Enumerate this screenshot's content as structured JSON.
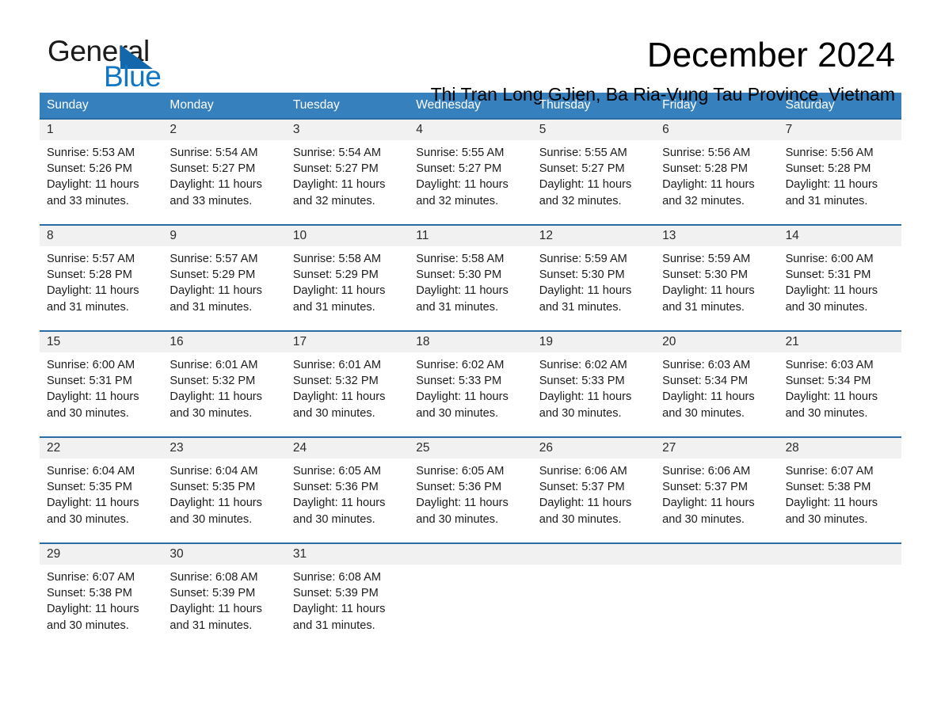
{
  "brand": {
    "name_part1": "General",
    "name_part2": "Blue",
    "triangle_color": "#1467ab",
    "blue_color": "#1176c4"
  },
  "header": {
    "title": "December 2024",
    "subtitle": "Thi Tran Long GJien, Ba Ria-Vung Tau Province, Vietnam"
  },
  "theme": {
    "header_bg": "#3680bd",
    "row_divider": "#2b6ca3",
    "date_band": "#f1f1f1"
  },
  "calendar": {
    "weekdays": [
      "Sunday",
      "Monday",
      "Tuesday",
      "Wednesday",
      "Thursday",
      "Friday",
      "Saturday"
    ],
    "weeks": [
      [
        {
          "day": "1",
          "sunrise": "Sunrise: 5:53 AM",
          "sunset": "Sunset: 5:26 PM",
          "daylight1": "Daylight: 11 hours",
          "daylight2": "and 33 minutes."
        },
        {
          "day": "2",
          "sunrise": "Sunrise: 5:54 AM",
          "sunset": "Sunset: 5:27 PM",
          "daylight1": "Daylight: 11 hours",
          "daylight2": "and 33 minutes."
        },
        {
          "day": "3",
          "sunrise": "Sunrise: 5:54 AM",
          "sunset": "Sunset: 5:27 PM",
          "daylight1": "Daylight: 11 hours",
          "daylight2": "and 32 minutes."
        },
        {
          "day": "4",
          "sunrise": "Sunrise: 5:55 AM",
          "sunset": "Sunset: 5:27 PM",
          "daylight1": "Daylight: 11 hours",
          "daylight2": "and 32 minutes."
        },
        {
          "day": "5",
          "sunrise": "Sunrise: 5:55 AM",
          "sunset": "Sunset: 5:27 PM",
          "daylight1": "Daylight: 11 hours",
          "daylight2": "and 32 minutes."
        },
        {
          "day": "6",
          "sunrise": "Sunrise: 5:56 AM",
          "sunset": "Sunset: 5:28 PM",
          "daylight1": "Daylight: 11 hours",
          "daylight2": "and 32 minutes."
        },
        {
          "day": "7",
          "sunrise": "Sunrise: 5:56 AM",
          "sunset": "Sunset: 5:28 PM",
          "daylight1": "Daylight: 11 hours",
          "daylight2": "and 31 minutes."
        }
      ],
      [
        {
          "day": "8",
          "sunrise": "Sunrise: 5:57 AM",
          "sunset": "Sunset: 5:28 PM",
          "daylight1": "Daylight: 11 hours",
          "daylight2": "and 31 minutes."
        },
        {
          "day": "9",
          "sunrise": "Sunrise: 5:57 AM",
          "sunset": "Sunset: 5:29 PM",
          "daylight1": "Daylight: 11 hours",
          "daylight2": "and 31 minutes."
        },
        {
          "day": "10",
          "sunrise": "Sunrise: 5:58 AM",
          "sunset": "Sunset: 5:29 PM",
          "daylight1": "Daylight: 11 hours",
          "daylight2": "and 31 minutes."
        },
        {
          "day": "11",
          "sunrise": "Sunrise: 5:58 AM",
          "sunset": "Sunset: 5:30 PM",
          "daylight1": "Daylight: 11 hours",
          "daylight2": "and 31 minutes."
        },
        {
          "day": "12",
          "sunrise": "Sunrise: 5:59 AM",
          "sunset": "Sunset: 5:30 PM",
          "daylight1": "Daylight: 11 hours",
          "daylight2": "and 31 minutes."
        },
        {
          "day": "13",
          "sunrise": "Sunrise: 5:59 AM",
          "sunset": "Sunset: 5:30 PM",
          "daylight1": "Daylight: 11 hours",
          "daylight2": "and 31 minutes."
        },
        {
          "day": "14",
          "sunrise": "Sunrise: 6:00 AM",
          "sunset": "Sunset: 5:31 PM",
          "daylight1": "Daylight: 11 hours",
          "daylight2": "and 30 minutes."
        }
      ],
      [
        {
          "day": "15",
          "sunrise": "Sunrise: 6:00 AM",
          "sunset": "Sunset: 5:31 PM",
          "daylight1": "Daylight: 11 hours",
          "daylight2": "and 30 minutes."
        },
        {
          "day": "16",
          "sunrise": "Sunrise: 6:01 AM",
          "sunset": "Sunset: 5:32 PM",
          "daylight1": "Daylight: 11 hours",
          "daylight2": "and 30 minutes."
        },
        {
          "day": "17",
          "sunrise": "Sunrise: 6:01 AM",
          "sunset": "Sunset: 5:32 PM",
          "daylight1": "Daylight: 11 hours",
          "daylight2": "and 30 minutes."
        },
        {
          "day": "18",
          "sunrise": "Sunrise: 6:02 AM",
          "sunset": "Sunset: 5:33 PM",
          "daylight1": "Daylight: 11 hours",
          "daylight2": "and 30 minutes."
        },
        {
          "day": "19",
          "sunrise": "Sunrise: 6:02 AM",
          "sunset": "Sunset: 5:33 PM",
          "daylight1": "Daylight: 11 hours",
          "daylight2": "and 30 minutes."
        },
        {
          "day": "20",
          "sunrise": "Sunrise: 6:03 AM",
          "sunset": "Sunset: 5:34 PM",
          "daylight1": "Daylight: 11 hours",
          "daylight2": "and 30 minutes."
        },
        {
          "day": "21",
          "sunrise": "Sunrise: 6:03 AM",
          "sunset": "Sunset: 5:34 PM",
          "daylight1": "Daylight: 11 hours",
          "daylight2": "and 30 minutes."
        }
      ],
      [
        {
          "day": "22",
          "sunrise": "Sunrise: 6:04 AM",
          "sunset": "Sunset: 5:35 PM",
          "daylight1": "Daylight: 11 hours",
          "daylight2": "and 30 minutes."
        },
        {
          "day": "23",
          "sunrise": "Sunrise: 6:04 AM",
          "sunset": "Sunset: 5:35 PM",
          "daylight1": "Daylight: 11 hours",
          "daylight2": "and 30 minutes."
        },
        {
          "day": "24",
          "sunrise": "Sunrise: 6:05 AM",
          "sunset": "Sunset: 5:36 PM",
          "daylight1": "Daylight: 11 hours",
          "daylight2": "and 30 minutes."
        },
        {
          "day": "25",
          "sunrise": "Sunrise: 6:05 AM",
          "sunset": "Sunset: 5:36 PM",
          "daylight1": "Daylight: 11 hours",
          "daylight2": "and 30 minutes."
        },
        {
          "day": "26",
          "sunrise": "Sunrise: 6:06 AM",
          "sunset": "Sunset: 5:37 PM",
          "daylight1": "Daylight: 11 hours",
          "daylight2": "and 30 minutes."
        },
        {
          "day": "27",
          "sunrise": "Sunrise: 6:06 AM",
          "sunset": "Sunset: 5:37 PM",
          "daylight1": "Daylight: 11 hours",
          "daylight2": "and 30 minutes."
        },
        {
          "day": "28",
          "sunrise": "Sunrise: 6:07 AM",
          "sunset": "Sunset: 5:38 PM",
          "daylight1": "Daylight: 11 hours",
          "daylight2": "and 30 minutes."
        }
      ],
      [
        {
          "day": "29",
          "sunrise": "Sunrise: 6:07 AM",
          "sunset": "Sunset: 5:38 PM",
          "daylight1": "Daylight: 11 hours",
          "daylight2": "and 30 minutes."
        },
        {
          "day": "30",
          "sunrise": "Sunrise: 6:08 AM",
          "sunset": "Sunset: 5:39 PM",
          "daylight1": "Daylight: 11 hours",
          "daylight2": "and 31 minutes."
        },
        {
          "day": "31",
          "sunrise": "Sunrise: 6:08 AM",
          "sunset": "Sunset: 5:39 PM",
          "daylight1": "Daylight: 11 hours",
          "daylight2": "and 31 minutes."
        },
        {
          "day": "",
          "sunrise": "",
          "sunset": "",
          "daylight1": "",
          "daylight2": ""
        },
        {
          "day": "",
          "sunrise": "",
          "sunset": "",
          "daylight1": "",
          "daylight2": ""
        },
        {
          "day": "",
          "sunrise": "",
          "sunset": "",
          "daylight1": "",
          "daylight2": ""
        },
        {
          "day": "",
          "sunrise": "",
          "sunset": "",
          "daylight1": "",
          "daylight2": ""
        }
      ]
    ]
  }
}
